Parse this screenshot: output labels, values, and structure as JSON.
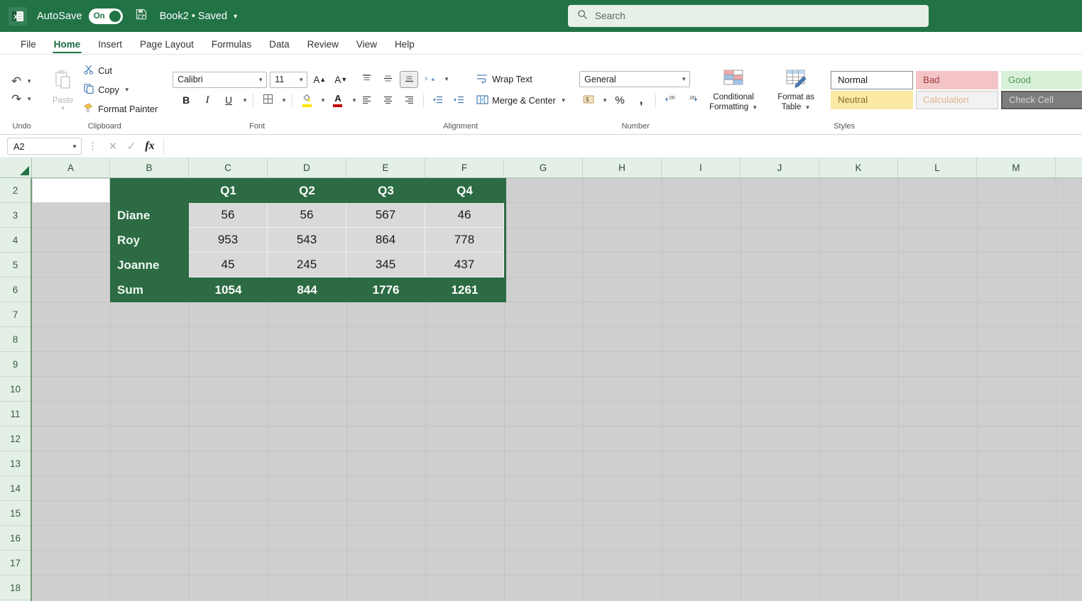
{
  "titlebar": {
    "autosave_label": "AutoSave",
    "autosave_state": "On",
    "document_title": "Book2  •  Saved",
    "app_icon": "excel-icon",
    "save_icon": "save-icon",
    "dropdown_icon": "chevron-down-icon"
  },
  "search": {
    "placeholder": "Search",
    "icon": "search-icon"
  },
  "tabs": [
    {
      "label": "File",
      "active": false
    },
    {
      "label": "Home",
      "active": true
    },
    {
      "label": "Insert",
      "active": false
    },
    {
      "label": "Page Layout",
      "active": false
    },
    {
      "label": "Formulas",
      "active": false
    },
    {
      "label": "Data",
      "active": false
    },
    {
      "label": "Review",
      "active": false
    },
    {
      "label": "View",
      "active": false
    },
    {
      "label": "Help",
      "active": false
    }
  ],
  "ribbon": {
    "undo": {
      "label": "Undo",
      "undo_icon": "undo-arrow-icon",
      "redo_icon": "redo-arrow-icon"
    },
    "clipboard": {
      "label": "Clipboard",
      "paste_label": "Paste",
      "cut_label": "Cut",
      "copy_label": "Copy",
      "format_painter_label": "Format Painter",
      "cut_icon": "scissors-icon",
      "copy_icon": "copy-icon",
      "format_painter_icon": "paintbrush-icon",
      "paste_icon": "clipboard-icon"
    },
    "font": {
      "label": "Font",
      "font_name": "Calibri",
      "font_size": "11",
      "grow_font": "A",
      "shrink_font": "A",
      "bold": "B",
      "italic": "I",
      "underline": "U",
      "borders_icon": "borders-icon",
      "fill_color_icon": "fill-color-icon",
      "font_color_icon": "font-color-icon",
      "fill_color": "#ffe600",
      "font_color": "#c00000"
    },
    "alignment": {
      "label": "Alignment",
      "wrap_text_label": "Wrap Text",
      "merge_center_label": "Merge & Center",
      "align_top_icon": "align-top-icon",
      "align_middle_icon": "align-middle-icon",
      "align_bottom_icon": "align-bottom-icon",
      "orientation_icon": "text-orientation-icon",
      "align_left_icon": "align-left-icon",
      "align_center_icon": "align-center-icon",
      "align_right_icon": "align-right-icon",
      "decrease_indent_icon": "decrease-indent-icon",
      "increase_indent_icon": "increase-indent-icon"
    },
    "number": {
      "label": "Number",
      "format": "General",
      "accounting_icon": "accounting-format-icon",
      "percent_label": "%",
      "comma_label": ",",
      "increase_decimal_icon": "increase-decimal-icon",
      "decrease_decimal_icon": "decrease-decimal-icon"
    },
    "styles": {
      "label": "Styles",
      "conditional_formatting_line1": "Conditional",
      "conditional_formatting_line2": "Formatting",
      "format_as_table_line1": "Format as",
      "format_as_table_line2": "Table",
      "conditional_formatting_icon": "conditional-formatting-icon",
      "format_as_table_icon": "format-as-table-icon",
      "gallery": [
        {
          "label": "Normal",
          "style": "g-normal"
        },
        {
          "label": "Bad",
          "style": "g-bad"
        },
        {
          "label": "Good",
          "style": "g-good"
        },
        {
          "label": "Neutral",
          "style": "g-neutral"
        },
        {
          "label": "Calculation",
          "style": "g-calc"
        },
        {
          "label": "Check Cell",
          "style": "g-check"
        }
      ]
    },
    "dialog_launcher_icon": "dialog-launcher-icon"
  },
  "formula_bar": {
    "name_box_value": "A2",
    "formula_value": "",
    "cancel_icon": "cancel-icon",
    "enter_icon": "checkmark-icon",
    "insert_function_icon": "fx-icon",
    "dropdown_icon": "chevron-down-icon",
    "more_icon": "more-options-icon"
  },
  "grid": {
    "select_all_icon": "select-all-icon",
    "column_headers": [
      "A",
      "B",
      "C",
      "D",
      "E",
      "F",
      "G",
      "H",
      "I",
      "J",
      "K",
      "L",
      "M"
    ],
    "row_headers": [
      "2",
      "3",
      "4",
      "5",
      "6",
      "7",
      "8",
      "9",
      "10",
      "11",
      "12",
      "13",
      "14",
      "15",
      "16",
      "17",
      "18"
    ],
    "active_cell": "A2",
    "theme": {
      "header_bg": "#e4f0e6",
      "table_green": "#2c6b43",
      "data_cell_bg": "#d9d9d9",
      "sheet_bg": "#cfcfcf"
    }
  },
  "chart_data": {
    "type": "table",
    "title": "",
    "categories": [
      "Q1",
      "Q2",
      "Q3",
      "Q4"
    ],
    "row_label_header": "",
    "series": [
      {
        "name": "Diane",
        "values": [
          56,
          56,
          567,
          46
        ]
      },
      {
        "name": "Roy",
        "values": [
          953,
          543,
          864,
          778
        ]
      },
      {
        "name": "Joanne",
        "values": [
          45,
          245,
          345,
          437
        ]
      }
    ],
    "summary_row": {
      "name": "Sum",
      "values": [
        1054,
        844,
        1776,
        1261
      ]
    }
  }
}
